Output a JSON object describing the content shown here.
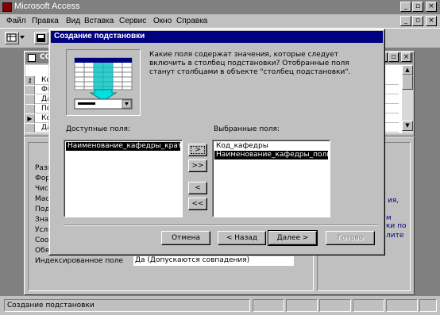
{
  "app": {
    "title": "Microsoft Access"
  },
  "menu": [
    "Файл",
    "Правка",
    "Вид",
    "Вставка",
    "Сервис",
    "Окно",
    "Справка"
  ],
  "table_window": {
    "title": "СОТ",
    "rows": [
      "Код",
      "ФИС",
      "Дат",
      "Пол",
      "Код",
      "Дат"
    ]
  },
  "properties": {
    "labels": [
      "Разм",
      "Форм",
      "Числ",
      "Маск",
      "Подп",
      "Знач",
      "Услов",
      "Сооб",
      "Обяз"
    ],
    "indexed_label": "Индексированное поле",
    "indexed_value": "Да (Допускаются совпадения)",
    "help_fragments": [
      "ия,",
      "м",
      "ки по",
      "лите"
    ]
  },
  "dialog": {
    "title": "Создание подстановки",
    "description": "Какие поля содержат значения, которые следует включить в столбец подстановки? Отобранные поля станут столбцами в объекте \"столбец подстановки\".",
    "available_label": "Доступные поля:",
    "selected_label": "Выбранные поля:",
    "available_fields": [
      "Наименование_кафедры_кратко"
    ],
    "selected_fields": [
      "Код_кафедры",
      "Наименование_кафедры_полное"
    ],
    "move_buttons": [
      ">",
      ">>",
      "<",
      "<<"
    ],
    "buttons": {
      "cancel": "Отмена",
      "back": "< Назад",
      "next": "Далее >",
      "finish": "Готово"
    }
  },
  "status": {
    "text": "Создание подстановки"
  }
}
